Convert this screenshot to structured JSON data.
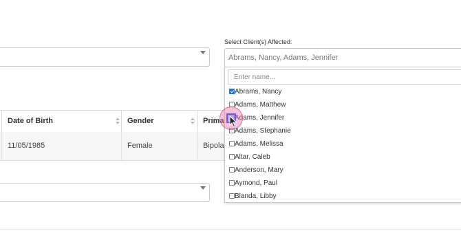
{
  "top_select": {
    "caret_icon": "chevron-down-icon"
  },
  "clients_field": {
    "label": "Select Client(s) Affected:",
    "summary": "Abrams, Nancy, Adams, Jennifer"
  },
  "table": {
    "columns": [
      "Date of Birth",
      "Gender",
      "Primar"
    ],
    "row": [
      "11/05/1985",
      "Female",
      "Bipolar"
    ]
  },
  "dropdown": {
    "search_placeholder": "Enter name...",
    "items": [
      {
        "label": "Abrams, Nancy",
        "checked": true
      },
      {
        "label": "Adams, Matthew",
        "checked": false
      },
      {
        "label": "Adams, Jennifer",
        "checked": false
      },
      {
        "label": "Adams, Stephanie",
        "checked": false
      },
      {
        "label": "Adams, Melissa",
        "checked": false
      },
      {
        "label": "Altar, Caleb",
        "checked": false
      },
      {
        "label": "Anderson, Mary",
        "checked": false
      },
      {
        "label": "Aymond, Paul",
        "checked": false
      },
      {
        "label": "Blanda, Libby",
        "checked": false
      }
    ]
  },
  "bottom_select": {
    "caret_icon": "chevron-down-icon"
  },
  "colors": {
    "checkbox_checked": "#1a73e8",
    "click_highlight": "#e678aa"
  }
}
